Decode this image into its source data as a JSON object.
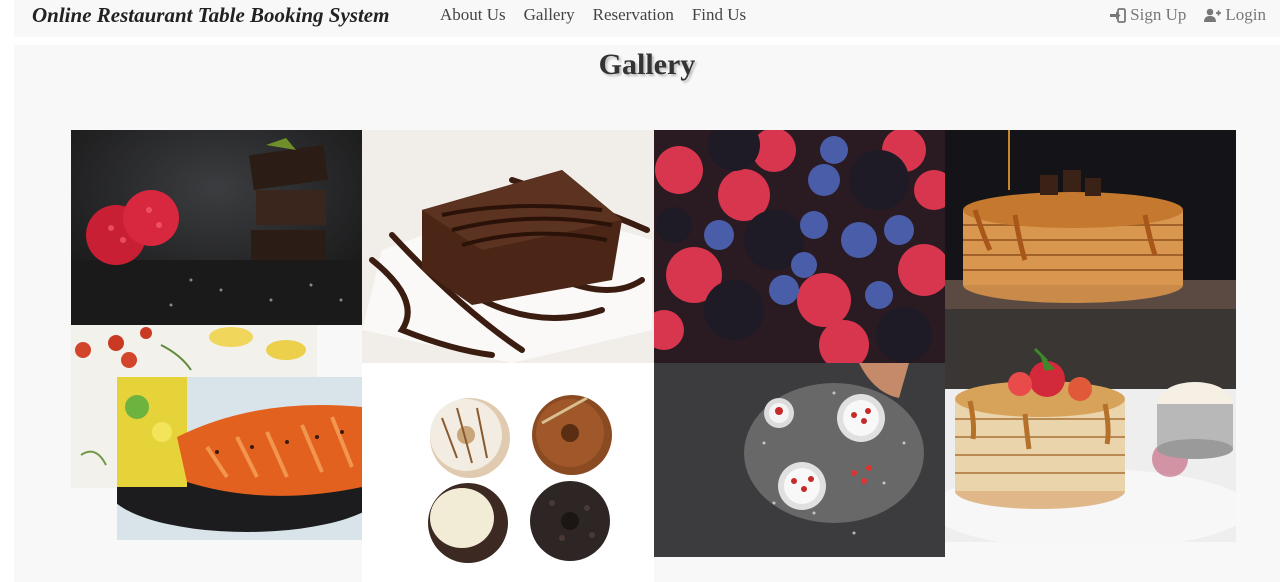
{
  "navbar": {
    "brand": "Online Restaurant Table Booking System",
    "links": [
      "About Us",
      "Gallery",
      "Reservation",
      "Find Us"
    ],
    "signup_label": "Sign Up",
    "login_label": "Login"
  },
  "page": {
    "title": "Gallery"
  },
  "gallery": {
    "images": [
      "raspberries-chocolate",
      "chocolate-brownie",
      "mixed-berries",
      "caramel-pancakes",
      "grilled-salmon",
      "glazed-donuts",
      "fruit-bowls-on-slate",
      "strawberry-pancakes"
    ]
  }
}
